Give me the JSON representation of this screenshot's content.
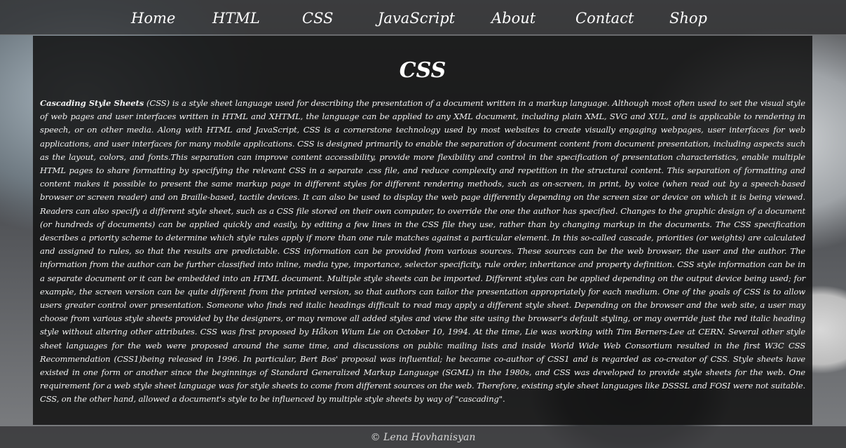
{
  "nav": {
    "items": [
      {
        "label": "Home"
      },
      {
        "label": "HTML"
      },
      {
        "label": "CSS"
      },
      {
        "label": "JavaScript"
      },
      {
        "label": "About"
      },
      {
        "label": "Contact"
      },
      {
        "label": "Shop"
      }
    ]
  },
  "main": {
    "title": "CSS",
    "lead_term": "Cascading Style Sheets",
    "body": " (CSS) is a style sheet language used for describing the presentation of a document written in a markup language. Although most often used to set the visual style of web pages and user interfaces written in HTML and XHTML, the language can be applied to any XML document, including plain XML, SVG and XUL, and is applicable to rendering in speech, or on other media. Along with HTML and JavaScript, CSS is a cornerstone technology used by most websites to create visually engaging webpages, user interfaces for web applications, and user interfaces for many mobile applications. CSS is designed primarily to enable the separation of document content from document presentation, including aspects such as the layout, colors, and fonts.This separation can improve content accessibility, provide more flexibility and control in the specification of presentation characteristics, enable multiple HTML pages to share formatting by specifying the relevant CSS in a separate .css file, and reduce complexity and repetition in the structural content. This separation of formatting and content makes it possible to present the same markup page in different styles for different rendering methods, such as on-screen, in print, by voice (when read out by a speech-based browser or screen reader) and on Braille-based, tactile devices. It can also be used to display the web page differently depending on the screen size or device on which it is being viewed. Readers can also specify a different style sheet, such as a CSS file stored on their own computer, to override the one the author has specified. Changes to the graphic design of a document (or hundreds of documents) can be applied quickly and easily, by editing a few lines in the CSS file they use, rather than by changing markup in the documents. The CSS specification describes a priority scheme to determine which style rules apply if more than one rule matches against a particular element. In this so-called cascade, priorities (or weights) are calculated and assigned to rules, so that the results are predictable. CSS information can be provided from various sources. These sources can be the web browser, the user and the author. The information from the author can be further classified into inline, media type, importance, selector specificity, rule order, inheritance and property definition. CSS style information can be in a separate document or it can be embedded into an HTML document. Multiple style sheets can be imported. Different styles can be applied depending on the output device being used; for example, the screen version can be quite different from the printed version, so that authors can tailor the presentation appropriately for each medium. One of the goals of CSS is to allow users greater control over presentation. Someone who finds red italic headings difficult to read may apply a different style sheet. Depending on the browser and the web site, a user may choose from various style sheets provided by the designers, or may remove all added styles and view the site using the browser's default styling, or may override just the red italic heading style without altering other attributes. CSS was first proposed by Håkon Wium Lie on October 10, 1994. At the time, Lie was working with Tim Berners-Lee at CERN. Several other style sheet languages for the web were proposed around the same time, and discussions on public mailing lists and inside World Wide Web Consortium resulted in the first W3C CSS Recommendation (CSS1)being released in 1996. In particular, Bert Bos' proposal was influential; he became co-author of CSS1 and is regarded as co-creator of CSS. Style sheets have existed in one form or another since the beginnings of Standard Generalized Markup Language (SGML) in the 1980s, and CSS was developed to provide style sheets for the web. One requirement for a web style sheet language was for style sheets to come from different sources on the web. Therefore, existing style sheet languages like DSSSL and FOSI were not suitable. CSS, on the other hand, allowed a document's style to be influenced by multiple style sheets by way of \"cascading\"."
  },
  "footer": {
    "text": "© Lena Hovhanisyan"
  }
}
